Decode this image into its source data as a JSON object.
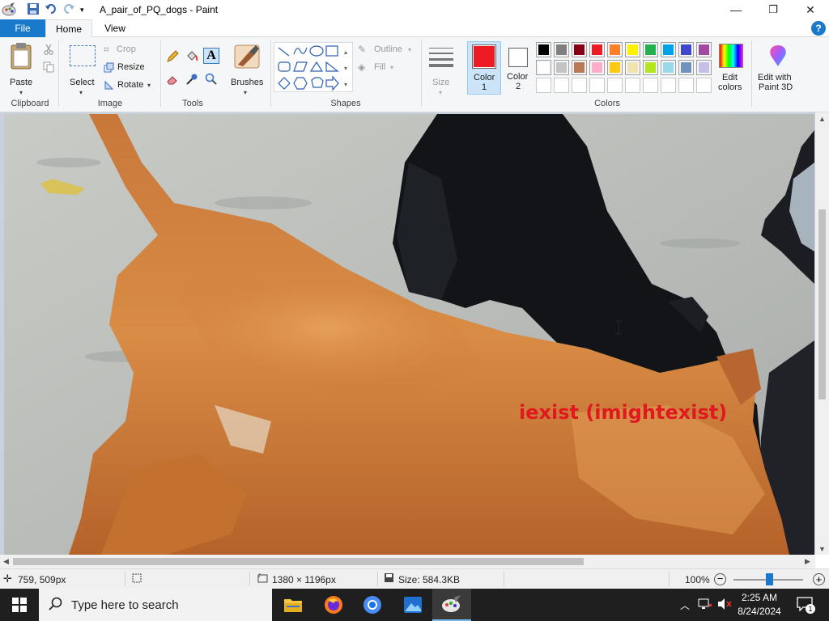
{
  "window": {
    "title": "A_pair_of_PQ_dogs - Paint",
    "minimize": "—",
    "maximize": "❐",
    "close": "✕"
  },
  "tabs": {
    "file": "File",
    "home": "Home",
    "view": "View",
    "help": "?"
  },
  "ribbon": {
    "clipboard": {
      "paste": "Paste",
      "label": "Clipboard"
    },
    "image": {
      "select": "Select",
      "crop": "Crop",
      "resize": "Resize",
      "rotate": "Rotate",
      "label": "Image"
    },
    "tools": {
      "label": "Tools"
    },
    "brushes": {
      "label": "Brushes"
    },
    "shapes": {
      "outline": "Outline",
      "fill": "Fill",
      "label": "Shapes"
    },
    "size": {
      "label": "Size"
    },
    "color1": {
      "label": "Color",
      "num": "1",
      "value": "#ed1c24"
    },
    "color2": {
      "label": "Color",
      "num": "2",
      "value": "#ffffff"
    },
    "colors": {
      "label": "Colors",
      "row1": [
        "#000000",
        "#7f7f7f",
        "#880015",
        "#ed1c24",
        "#ff7f27",
        "#fff200",
        "#22b14c",
        "#00a2e8",
        "#3f48cc",
        "#a349a4"
      ],
      "row2": [
        "#ffffff",
        "#c3c3c3",
        "#b97a57",
        "#ffaec9",
        "#ffc90e",
        "#efe4b0",
        "#b5e61d",
        "#99d9ea",
        "#7092be",
        "#c8bfe7"
      ]
    },
    "edit_colors": {
      "line1": "Edit",
      "line2": "colors"
    },
    "paint3d": {
      "line1": "Edit with",
      "line2": "Paint 3D"
    }
  },
  "canvas": {
    "annotation_text": "iexist (imightexist)",
    "annotation_color": "#e0191e"
  },
  "status": {
    "cursor_pos": "759, 509px",
    "dimensions": "1380 × 1196px",
    "size": "Size: 584.3KB",
    "zoom": "100%"
  },
  "taskbar": {
    "search_placeholder": "Type here to search",
    "time": "2:25 AM",
    "date": "8/24/2024",
    "notification_count": "1"
  }
}
